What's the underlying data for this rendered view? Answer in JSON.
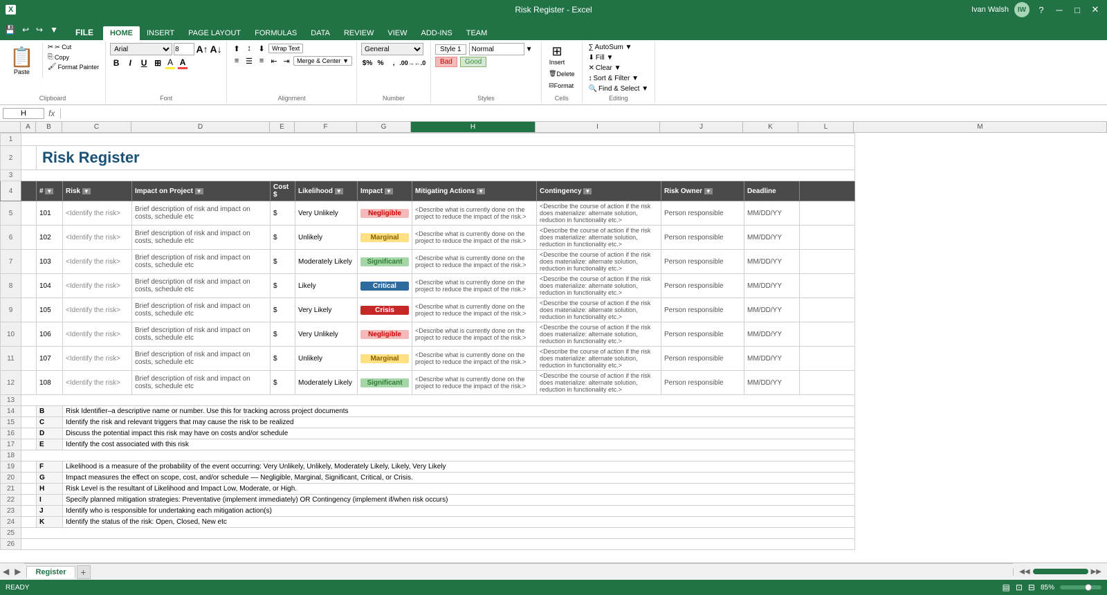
{
  "titleBar": {
    "title": "Risk Register - Excel",
    "userLabel": "Ivan Walsh",
    "windowBtns": [
      "?",
      "─",
      "□",
      "✕"
    ]
  },
  "quickAccess": {
    "buttons": [
      "💾",
      "↩",
      "↪",
      "▼"
    ]
  },
  "ribbonTabs": [
    {
      "label": "FILE",
      "active": false
    },
    {
      "label": "HOME",
      "active": true
    },
    {
      "label": "INSERT",
      "active": false
    },
    {
      "label": "PAGE LAYOUT",
      "active": false
    },
    {
      "label": "FORMULAS",
      "active": false
    },
    {
      "label": "DATA",
      "active": false
    },
    {
      "label": "REVIEW",
      "active": false
    },
    {
      "label": "VIEW",
      "active": false
    },
    {
      "label": "ADD-INS",
      "active": false
    },
    {
      "label": "TEAM",
      "active": false
    }
  ],
  "ribbon": {
    "clipboard": {
      "label": "Clipboard",
      "paste": "Paste",
      "cut": "✂ Cut",
      "copy": "Copy",
      "format_painter": "Format Painter"
    },
    "font": {
      "label": "Font",
      "name": "Arial",
      "size": "8"
    },
    "alignment": {
      "label": "Alignment",
      "wrap_text": "Wrap Text",
      "merge": "Merge & Center ▼"
    },
    "number": {
      "label": "Number",
      "format": "General"
    },
    "styles": {
      "label": "Styles",
      "style1": "Style 1",
      "normal": "Normal",
      "bad": "Bad",
      "good": "Good"
    },
    "cells": {
      "label": "Cells",
      "insert": "Insert",
      "delete": "Delete",
      "format": "Format"
    },
    "editing": {
      "label": "Editing",
      "autosum": "∑ AutoSum ▼",
      "fill": "⬇ Fill ▼",
      "clear": "Clear ▼",
      "sort_filter": "Sort & Filter ▼",
      "find_select": "Find & Select ▼"
    }
  },
  "formulaBar": {
    "cellRef": "H",
    "formula": ""
  },
  "spreadsheet": {
    "title": "Risk Register",
    "headers": {
      "num": "#",
      "risk": "Risk",
      "impact": "Impact on Project",
      "cost": "Cost $",
      "likelihood": "Likelihood",
      "impactLevel": "Impact",
      "mitigating": "Mitigating Actions",
      "contingency": "Contingency",
      "owner": "Risk Owner",
      "deadline": "Deadline"
    },
    "rows": [
      {
        "rowNum": 4,
        "num": "101",
        "risk": "<Identify the risk>",
        "impact": "Brief description of risk and impact on costs, schedule etc",
        "cost": "$",
        "likelihood": "Very Unlikely",
        "impactLevel": "Negligible",
        "impactClass": "negligible",
        "mitigating": "<Describe what is currently done on the project to reduce the impact of the risk.>",
        "contingency": "<Describe the course of action if the risk does materialize: alternate solution, reduction in functionality etc.>",
        "owner": "Person responsible",
        "deadline": "MM/DD/YY"
      },
      {
        "rowNum": 5,
        "num": "102",
        "risk": "<Identify the risk>",
        "impact": "Brief description of risk and impact on costs, schedule etc",
        "cost": "$",
        "likelihood": "Unlikely",
        "impactLevel": "Marginal",
        "impactClass": "marginal",
        "mitigating": "<Describe what is currently done on the project to reduce the impact of the risk.>",
        "contingency": "<Describe the course of action if the risk does materialize: alternate solution, reduction in functionality etc.>",
        "owner": "Person responsible",
        "deadline": "MM/DD/YY"
      },
      {
        "rowNum": 6,
        "num": "103",
        "risk": "<Identify the risk>",
        "impact": "Brief description of risk and impact on costs, schedule etc",
        "cost": "$",
        "likelihood": "Moderately Likely",
        "impactLevel": "Significant",
        "impactClass": "significant",
        "mitigating": "<Describe what is currently done on the project to reduce the impact of the risk.>",
        "contingency": "<Describe the course of action if the risk does materialize: alternate solution, reduction in functionality etc.>",
        "owner": "Person responsible",
        "deadline": "MM/DD/YY"
      },
      {
        "rowNum": 7,
        "num": "104",
        "risk": "<Identify the risk>",
        "impact": "Brief description of risk and impact on costs, schedule etc",
        "cost": "$",
        "likelihood": "Likely",
        "impactLevel": "Critical",
        "impactClass": "critical",
        "mitigating": "<Describe what is currently done on the project to reduce the impact of the risk.>",
        "contingency": "<Describe the course of action if the risk does materialize: alternate solution, reduction in functionality etc.>",
        "owner": "Person responsible",
        "deadline": "MM/DD/YY"
      },
      {
        "rowNum": 8,
        "num": "105",
        "risk": "<Identify the risk>",
        "impact": "Brief description of risk and impact on costs, schedule etc",
        "cost": "$",
        "likelihood": "Very Likely",
        "impactLevel": "Crisis",
        "impactClass": "crisis",
        "mitigating": "<Describe what is currently done on the project to reduce the impact of the risk.>",
        "contingency": "<Describe the course of action if the risk does materialize: alternate solution, reduction in functionality etc.>",
        "owner": "Person responsible",
        "deadline": "MM/DD/YY"
      },
      {
        "rowNum": 9,
        "num": "106",
        "risk": "<Identify the risk>",
        "impact": "Brief description of risk and impact on costs, schedule etc",
        "cost": "$",
        "likelihood": "Very Unlikely",
        "impactLevel": "Negligible",
        "impactClass": "negligible",
        "mitigating": "<Describe what is currently done on the project to reduce the impact of the risk.>",
        "contingency": "<Describe the course of action if the risk does materialize: alternate solution, reduction in functionality etc.>",
        "owner": "Person responsible",
        "deadline": "MM/DD/YY"
      },
      {
        "rowNum": 10,
        "num": "107",
        "risk": "<Identify the risk>",
        "impact": "Brief description of risk and impact on costs, schedule etc",
        "cost": "$",
        "likelihood": "Unlikely",
        "impactLevel": "Marginal",
        "impactClass": "marginal",
        "mitigating": "<Describe what is currently done on the project to reduce the impact of the risk.>",
        "contingency": "<Describe the course of action if the risk does materialize: alternate solution, reduction in functionality etc.>",
        "owner": "Person responsible",
        "deadline": "MM/DD/YY"
      },
      {
        "rowNum": 11,
        "num": "108",
        "risk": "<Identify the risk>",
        "impact": "Brief description of risk and impact on costs, schedule etc",
        "cost": "$",
        "likelihood": "Moderately Likely",
        "impactLevel": "Significant",
        "impactClass": "significant",
        "mitigating": "<Describe what is currently done on the project to reduce the impact of the risk.>",
        "contingency": "<Describe the course of action if the risk does materialize: alternate solution, reduction in functionality etc.>",
        "owner": "Person responsible",
        "deadline": "MM/DD/YY"
      }
    ],
    "legend": [
      {
        "key": "B",
        "desc": "Risk Identifier–a descriptive name or number. Use this for tracking across project documents"
      },
      {
        "key": "C",
        "desc": "Identify the risk and relevant triggers that may cause the risk to be realized"
      },
      {
        "key": "D",
        "desc": "Discuss the potential impact this risk may have on costs and/or schedule"
      },
      {
        "key": "E",
        "desc": "Identify the cost associated with this risk"
      },
      {
        "key": "",
        "desc": ""
      },
      {
        "key": "F",
        "desc": "Likelihood is a measure of the probability of the event occurring: Very Unlikely, Unlikely, Moderately Likely, Likely, Very Likely"
      },
      {
        "key": "G",
        "desc": "Impact measures the effect on scope, cost, and/or schedule –– Negligible, Marginal, Significant, Critical, or Crisis."
      },
      {
        "key": "H",
        "desc": "Risk Level is the resultant of Likelihood and Impact Low, Moderate, or High."
      },
      {
        "key": "I",
        "desc": "Specify planned mitigation strategies: Preventative (implement immediately) OR Contingency (implement if/when risk occurs)"
      },
      {
        "key": "J",
        "desc": "Identify who is responsible for undertaking each mitigation action(s)"
      },
      {
        "key": "K",
        "desc": "Identify the status of the risk: Open, Closed, New etc"
      }
    ]
  },
  "sheetTabs": [
    {
      "label": "Register",
      "active": true
    }
  ],
  "statusBar": {
    "status": "READY",
    "icons": [
      "📊",
      "📋"
    ],
    "zoom": "85%"
  }
}
